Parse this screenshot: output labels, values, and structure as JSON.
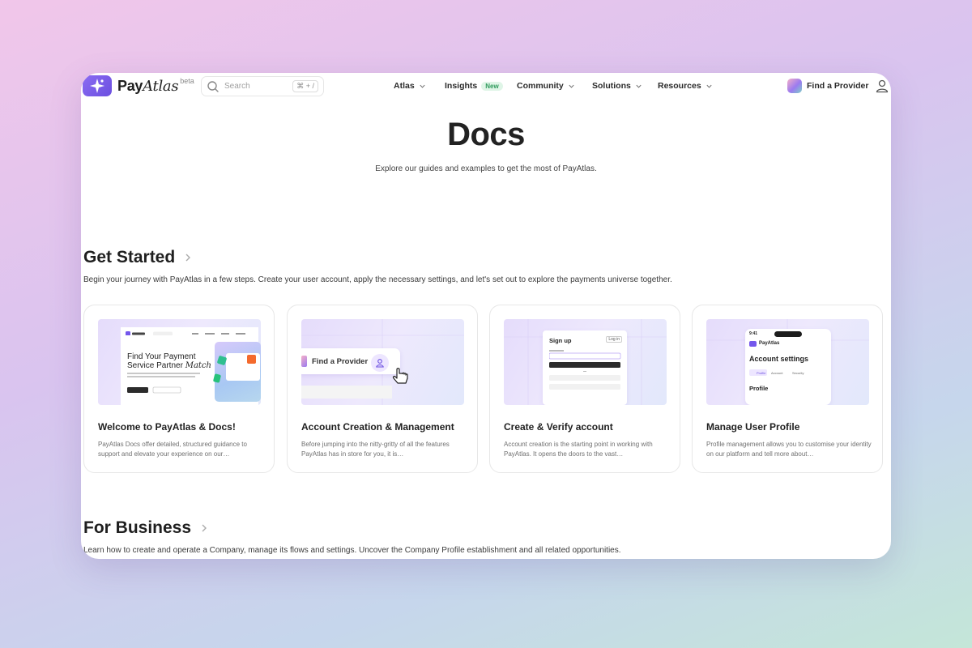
{
  "brand": {
    "name_main": "Pay",
    "name_accent": "Atlas",
    "beta": "beta"
  },
  "search": {
    "placeholder": "Search",
    "shortcut": "⌘ + /"
  },
  "nav": {
    "items": [
      {
        "label": "Atlas",
        "has_chevron": true
      },
      {
        "label": "Insights",
        "badge": "New"
      },
      {
        "label": "Community",
        "has_chevron": true
      },
      {
        "label": "Solutions",
        "has_chevron": true
      },
      {
        "label": "Resources",
        "has_chevron": true
      }
    ],
    "cta": "Find a Provider"
  },
  "hero": {
    "title": "Docs",
    "subtitle": "Explore our guides and examples to get the most of PayAtlas."
  },
  "get_started": {
    "title": "Get Started",
    "description": "Begin your journey with PayAtlas in a few steps. Create your user account, apply the necessary settings, and let's set out to explore the payments universe together.",
    "cards": [
      {
        "title": "Welcome to PayAtlas & Docs!",
        "description": "PayAtlas Docs offer detailed, structured guidance to support and elevate your experience on our…",
        "thumb_heading_1": "Find Your Payment",
        "thumb_heading_2": "Service Partner",
        "thumb_heading_accent": "Match"
      },
      {
        "title": "Account Creation & Management",
        "description": "Before jumping into the nitty-gritty of all the features PayAtlas has in store for you, it is…",
        "thumb_label": "Find a Provider"
      },
      {
        "title": "Create & Verify account",
        "description": "Account creation is the starting point in working with PayAtlas. It opens the doors to the vast…",
        "thumb_heading": "Sign up",
        "thumb_login": "Log in"
      },
      {
        "title": "Manage User Profile",
        "description": "Profile management allows you to customise your identity on our platform and tell more about…",
        "thumb_time": "9:41",
        "thumb_brand": "PayAtlas",
        "thumb_heading": "Account settings",
        "thumb_tabs": [
          "Profile",
          "Account",
          "Security"
        ],
        "thumb_section": "Profile"
      }
    ]
  },
  "for_business": {
    "title": "For Business",
    "description": "Learn how to create and operate a Company, manage its flows and settings. Uncover the Company Profile establishment and all related opportunities."
  },
  "colors": {
    "brand_purple": "#7457ec",
    "badge_green": "#2f9a5c",
    "text_dark": "#1f1f1f"
  }
}
